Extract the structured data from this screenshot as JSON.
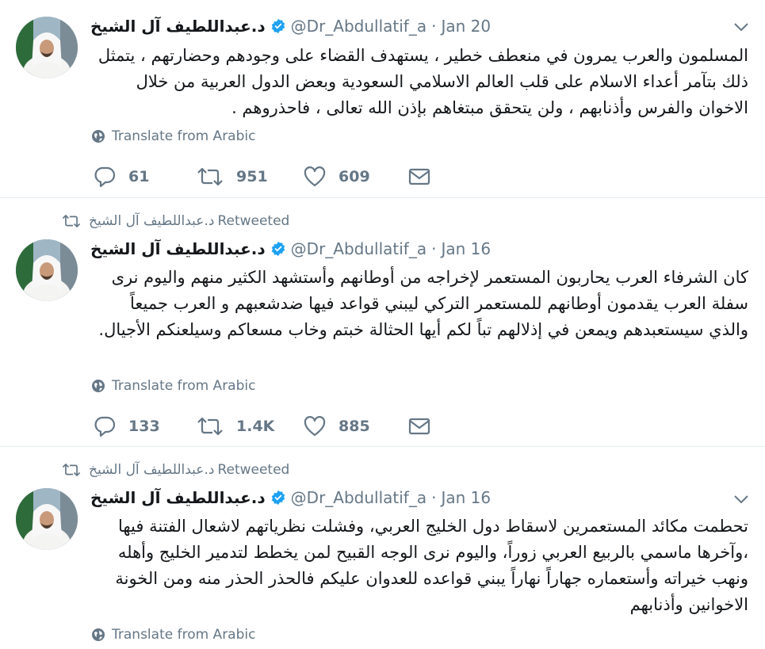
{
  "tweets": [
    {
      "retweeted": false,
      "author_name": "د.عبداللطيف آل الشيخ",
      "handle": "@Dr_Abdullatif_a",
      "separator": "·",
      "date": "Jan 20",
      "text": "المسلمون والعرب يمرون في منعطف خطير ، يستهدف القضاء على وجودهم وحضارتهم ، يتمثل ذلك بتآمر  أعداء الاسلام على قلب العالم الاسلامي السعودية وبعض الدول العربية من خلال الاخوان والفرس وأذنابهم ، ولن يتحقق مبتغاهم بإذن الله تعالى ، فاحذروهم .",
      "translate_label": "Translate from Arabic",
      "replies": "61",
      "retweets": "951",
      "likes": "609"
    },
    {
      "retweeted": true,
      "retweeter_name": "د.عبداللطيف آل الشيخ",
      "retweeted_label": "Retweeted",
      "author_name": "د.عبداللطيف آل الشيخ",
      "handle": "@Dr_Abdullatif_a",
      "separator": "·",
      "date": "Jan 16",
      "text": "كان الشرفاء  العرب يحاربون المستعمر لإخراجه من أوطانهم وأستشهد الكثير منهم واليوم نرى سفلة العرب يقدمون أوطانهم للمستعمر التركي ليبني قواعد فيها ضدشعبهم و العرب جميعاً والذي سيستعبدهم ويمعن في إذلالهم تباً لكم أيها الحثالة خبتم وخاب مسعاكم وسيلعنكم الأجيال.",
      "translate_label": "Translate from Arabic",
      "replies": "133",
      "retweets": "1.4K",
      "likes": "885"
    },
    {
      "retweeted": true,
      "retweeter_name": "د.عبداللطيف آل الشيخ",
      "retweeted_label": "Retweeted",
      "author_name": "د.عبداللطيف آل الشيخ",
      "handle": "@Dr_Abdullatif_a",
      "separator": "·",
      "date": "Jan 16",
      "text": "تحطمت مكائد المستعمرين لاسقاط دول الخليج العربي، وفشلت نظرياتهم لاشعال الفتنة فيها ،وآخرها ماسمي بالربيع العربي زوراً، واليوم نرى الوجه القبيح لمن يخطط لتدمير الخليج وأهله ونهب خيراته وأستعماره جهاراً نهاراً يبني قواعده للعدوان عليكم فالحذر الحذر منه ومن الخونة الاخوانين وأذنابهم",
      "translate_label": "Translate from Arabic"
    }
  ],
  "colors": {
    "text": "#14171a",
    "secondary": "#657786",
    "verified": "#1da1f2",
    "divider": "#e6ecf0"
  },
  "icons": [
    "verified-badge-icon",
    "caret-down-icon",
    "globe-icon",
    "reply-icon",
    "retweet-icon",
    "like-icon",
    "direct-message-icon"
  ]
}
